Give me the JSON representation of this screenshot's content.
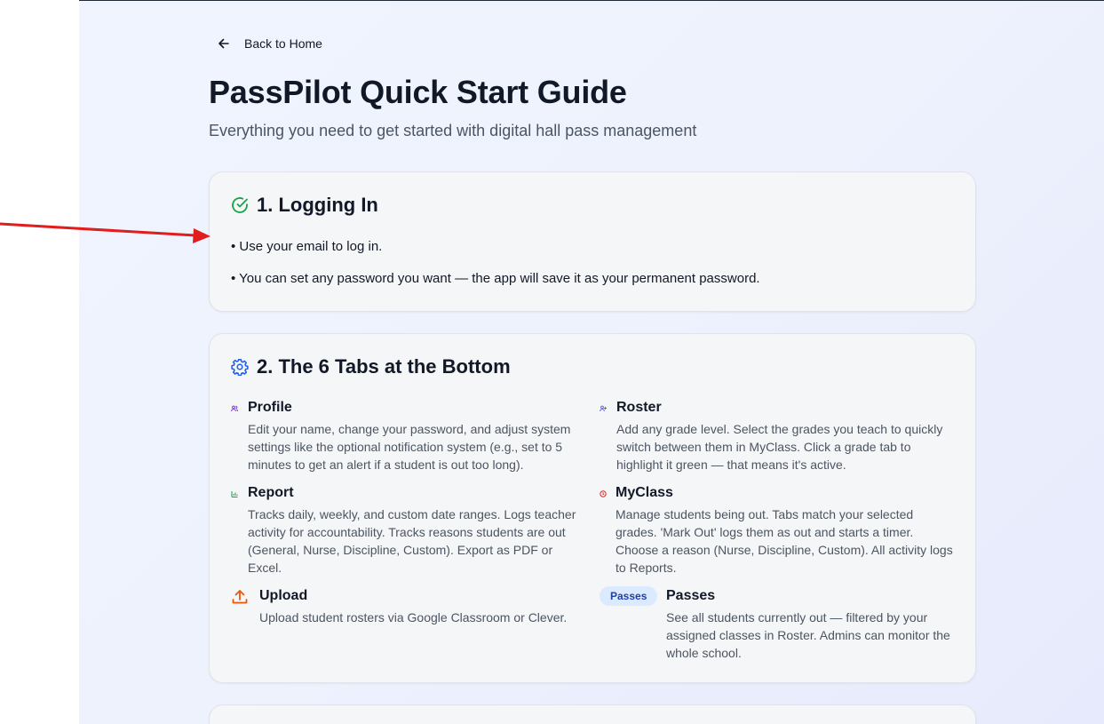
{
  "nav": {
    "back_label": "Back to Home"
  },
  "header": {
    "title": "PassPilot Quick Start Guide",
    "subtitle": "Everything you need to get started with digital hall pass management"
  },
  "section1": {
    "title": "1. Logging In",
    "bullets": [
      "• Use your email to log in.",
      "• You can set any password you want — the app will save it as your permanent password."
    ]
  },
  "section2": {
    "title": "2. The 6 Tabs at the Bottom",
    "tabs": [
      {
        "title": "Profile",
        "description": "Edit your name, change your password, and adjust system settings like the optional notification system (e.g., set to 5 minutes to get an alert if a student is out too long)."
      },
      {
        "title": "Roster",
        "description": "Add any grade level. Select the grades you teach to quickly switch between them in MyClass. Click a grade tab to highlight it green — that means it's active."
      },
      {
        "title": "Report",
        "description": "Tracks daily, weekly, and custom date ranges. Logs teacher activity for accountability. Tracks reasons students are out (General, Nurse, Discipline, Custom). Export as PDF or Excel."
      },
      {
        "title": "MyClass",
        "description": "Manage students being out. Tabs match your selected grades. 'Mark Out' logs them as out and starts a timer. Choose a reason (Nurse, Discipline, Custom). All activity logs to Reports."
      },
      {
        "title": "Upload",
        "description": "Upload student rosters via Google Classroom or Clever."
      },
      {
        "title": "Passes",
        "badge": "Passes",
        "description": "See all students currently out — filtered by your assigned classes in Roster. Admins can monitor the whole school."
      }
    ]
  },
  "colors": {
    "check": "#16a34a",
    "gear": "#2563eb",
    "profile_icon": "#7c3aed",
    "roster_icon": "#6366f1",
    "report_icon": "#16a34a",
    "myclass_icon": "#dc2626",
    "upload_icon": "#ea580c",
    "annotation_arrow": "#e11d1d"
  }
}
